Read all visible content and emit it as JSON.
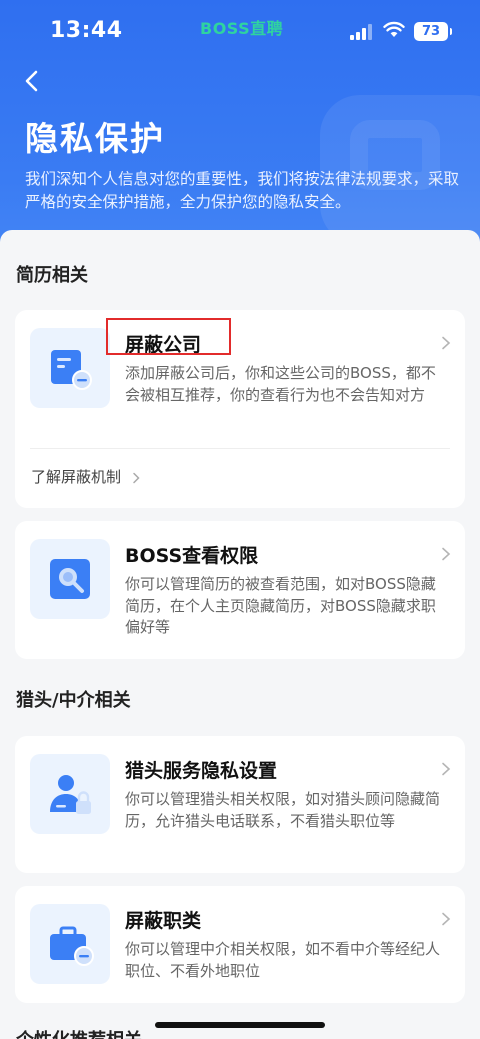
{
  "status_bar": {
    "time": "13:44",
    "carrier": "BOSS直聘",
    "battery": "73"
  },
  "header": {
    "title": "隐私保护",
    "description": "我们深知个人信息对您的重要性，我们将按法律法规要求，采取严格的安全保护措施，全力保护您的隐私安全。"
  },
  "sections": [
    {
      "title": "简历相关",
      "items": [
        {
          "title": "屏蔽公司",
          "desc": "添加屏蔽公司后，你和这些公司的BOSS，都不会被相互推荐，你的查看行为也不会告知对方",
          "link": "了解屏蔽机制",
          "icon": "shield-company-icon"
        },
        {
          "title": "BOSS查看权限",
          "desc": "你可以管理简历的被查看范围，如对BOSS隐藏简历，在个人主页隐藏简历，对BOSS隐藏求职偏好等",
          "icon": "search-view-icon"
        }
      ]
    },
    {
      "title": "猎头/中介相关",
      "items": [
        {
          "title": "猎头服务隐私设置",
          "desc": "你可以管理猎头相关权限，如对猎头顾问隐藏简历，允许猎头电话联系，不看猎头职位等",
          "icon": "user-lock-icon"
        },
        {
          "title": "屏蔽职类",
          "desc": "你可以管理中介相关权限，如不看中介等经纪人职位、不看外地职位",
          "icon": "briefcase-block-icon"
        }
      ]
    },
    {
      "title": "个性化推荐相关"
    }
  ],
  "colors": {
    "brand": "#2f6ff0",
    "icon_blue": "#3b7ff5",
    "tile_bg": "#ebf3fe",
    "highlight": "#e22b2b"
  }
}
